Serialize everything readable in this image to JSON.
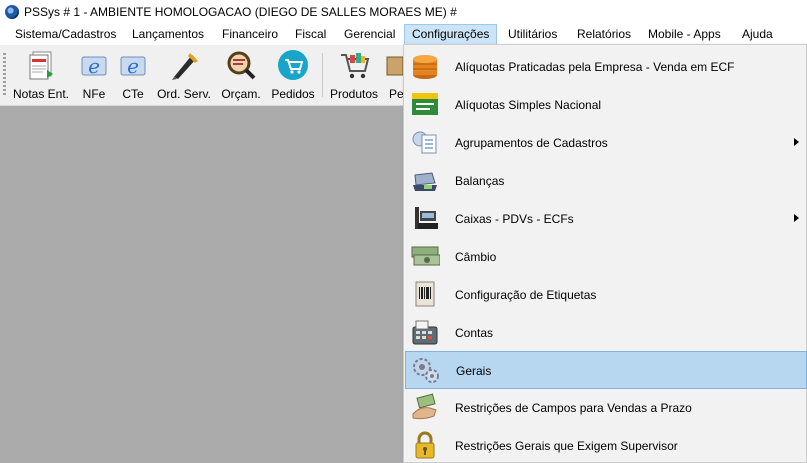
{
  "window": {
    "title": "PSSys # 1 - AMBIENTE HOMOLOGACAO (DIEGO DE SALLES MORAES ME) #",
    "icon": "pssys-logo-icon"
  },
  "menubar": {
    "items": [
      {
        "label": "Sistema/Cadastros"
      },
      {
        "label": "Lançamentos"
      },
      {
        "label": "Financeiro"
      },
      {
        "label": "Fiscal"
      },
      {
        "label": "Gerencial"
      },
      {
        "label": "Configurações",
        "active": true
      },
      {
        "label": "Utilitários"
      },
      {
        "label": "Relatórios"
      },
      {
        "label": "Mobile - Apps"
      },
      {
        "label": "Ajuda"
      }
    ]
  },
  "toolbar": {
    "buttons": [
      {
        "label": "Notas Ent.",
        "icon": "invoice-entry-icon"
      },
      {
        "label": "NFe",
        "icon": "nfe-icon"
      },
      {
        "label": "CTe",
        "icon": "cte-icon"
      },
      {
        "label": "Ord. Serv.",
        "icon": "service-order-icon"
      },
      {
        "label": "Orçam.",
        "icon": "budget-icon"
      },
      {
        "label": "Pedidos",
        "icon": "orders-icon"
      },
      {
        "label": "Produtos",
        "icon": "products-icon"
      },
      {
        "label": "Pe",
        "icon": "partial-icon"
      }
    ]
  },
  "configuracoes_menu": {
    "items": [
      {
        "label": "Alíquotas Praticadas pela Empresa - Venda em ECF",
        "icon": "coins-icon",
        "submenu": false
      },
      {
        "label": "Alíquotas Simples Nacional",
        "icon": "simples-nacional-icon",
        "submenu": false
      },
      {
        "label": "Agrupamentos de Cadastros",
        "icon": "grouping-icon",
        "submenu": true
      },
      {
        "label": "Balanças",
        "icon": "scale-icon",
        "submenu": false
      },
      {
        "label": "Caixas - PDVs - ECFs",
        "icon": "cash-register-icon",
        "submenu": true
      },
      {
        "label": "Câmbio",
        "icon": "currency-exchange-icon",
        "submenu": false
      },
      {
        "label": "Configuração de Etiquetas",
        "icon": "barcode-label-icon",
        "submenu": false
      },
      {
        "label": "Contas",
        "icon": "calculator-icon",
        "submenu": false
      },
      {
        "label": "Gerais",
        "icon": "gears-icon",
        "submenu": false,
        "highlighted": true
      },
      {
        "label": "Restrições de Campos para Vendas a Prazo",
        "icon": "hand-money-icon",
        "submenu": false
      },
      {
        "label": "Restrições Gerais que Exigem Supervisor",
        "icon": "padlock-icon",
        "submenu": false
      }
    ]
  }
}
